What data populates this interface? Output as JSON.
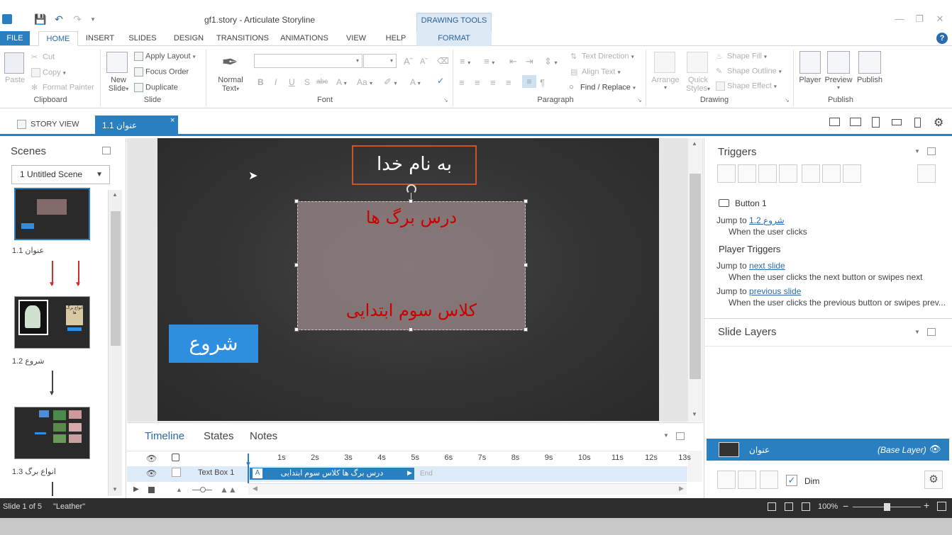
{
  "window": {
    "title": "gf1.story - Articulate Storyline",
    "drawing_tools": "DRAWING TOOLS"
  },
  "ribbon_tabs": {
    "file": "FILE",
    "home": "HOME",
    "insert": "INSERT",
    "slides": "SLIDES",
    "design": "DESIGN",
    "transitions": "TRANSITIONS",
    "animations": "ANIMATIONS",
    "view": "VIEW",
    "help": "HELP",
    "format": "FORMAT"
  },
  "clipboard": {
    "paste": "Paste",
    "cut": "Cut",
    "copy": "Copy",
    "format_painter": "Format Painter",
    "label": "Clipboard"
  },
  "slide_group": {
    "new_slide_1": "New",
    "new_slide_2": "Slide",
    "apply_layout": "Apply Layout",
    "focus_order": "Focus Order",
    "duplicate": "Duplicate",
    "label": "Slide"
  },
  "normal_text": {
    "line1": "Normal",
    "line2": "Text"
  },
  "font_group": {
    "label": "Font",
    "bold": "B",
    "italic": "I",
    "underline": "U",
    "shadow": "S",
    "strike": "abc",
    "font_color": "A",
    "change_case": "Aa"
  },
  "paragraph_group": {
    "text_direction": "Text Direction",
    "align_text": "Align Text",
    "find_replace": "Find / Replace",
    "label": "Paragraph"
  },
  "drawing_group": {
    "arrange": "Arrange",
    "quick_styles_1": "Quick",
    "quick_styles_2": "Styles",
    "shape_fill": "Shape Fill",
    "shape_outline": "Shape Outline",
    "shape_effect": "Shape Effect",
    "label": "Drawing"
  },
  "publish_group": {
    "player": "Player",
    "preview": "Preview",
    "publish": "Publish",
    "label": "Publish"
  },
  "story_tabs": {
    "story_view": "STORY VIEW",
    "slide_tab": "1.1 عنوان",
    "close": "×"
  },
  "scenes": {
    "title": "Scenes",
    "selected_scene": "1 Untitled Scene",
    "slides": [
      {
        "label": "1.1 عنوان"
      },
      {
        "label": "1.2 شروع"
      },
      {
        "label": "1.3 انواع برگ"
      }
    ]
  },
  "slide_canvas": {
    "title_text": "به نام خدا",
    "content_line1": "درس  برگ ها",
    "content_line2": "کلاس سوم ابتدایی",
    "start_button": "شروع",
    "thumb2_text": "انواع برگ ها"
  },
  "timeline": {
    "tabs": {
      "timeline": "Timeline",
      "states": "States",
      "notes": "Notes"
    },
    "ticks": [
      "1s",
      "2s",
      "3s",
      "4s",
      "5s",
      "6s",
      "7s",
      "8s",
      "9s",
      "10s",
      "11s",
      "12s",
      "13s"
    ],
    "row_label": "Text Box 1",
    "bar_text": "درس برگ ها کلاس سوم ابتدایی",
    "end_label": "End",
    "bar_prefix": "A"
  },
  "triggers": {
    "title": "Triggers",
    "object_name": "Button 1",
    "jump_to": "Jump to",
    "t1_target": "1.2 شروع",
    "t1_when": "When the user clicks",
    "player_triggers": "Player Triggers",
    "t2_target": "next slide",
    "t2_when": "When the user clicks the next button or swipes next",
    "t3_target": "previous slide",
    "t3_when": "When the user clicks the previous button or swipes prev..."
  },
  "slide_layers": {
    "title": "Slide Layers",
    "base_name": "عنوان",
    "base_tag": "(Base Layer)",
    "dim_label": "Dim",
    "dim_checked": true
  },
  "status": {
    "slide_count": "Slide 1 of 5",
    "theme": "\"Leather\"",
    "zoom": "100%",
    "zoom_minus": "−",
    "zoom_plus": "+"
  },
  "colors": {
    "accent": "#2a7fc1",
    "title_border": "#c8552a",
    "content_red": "#cc0000"
  }
}
